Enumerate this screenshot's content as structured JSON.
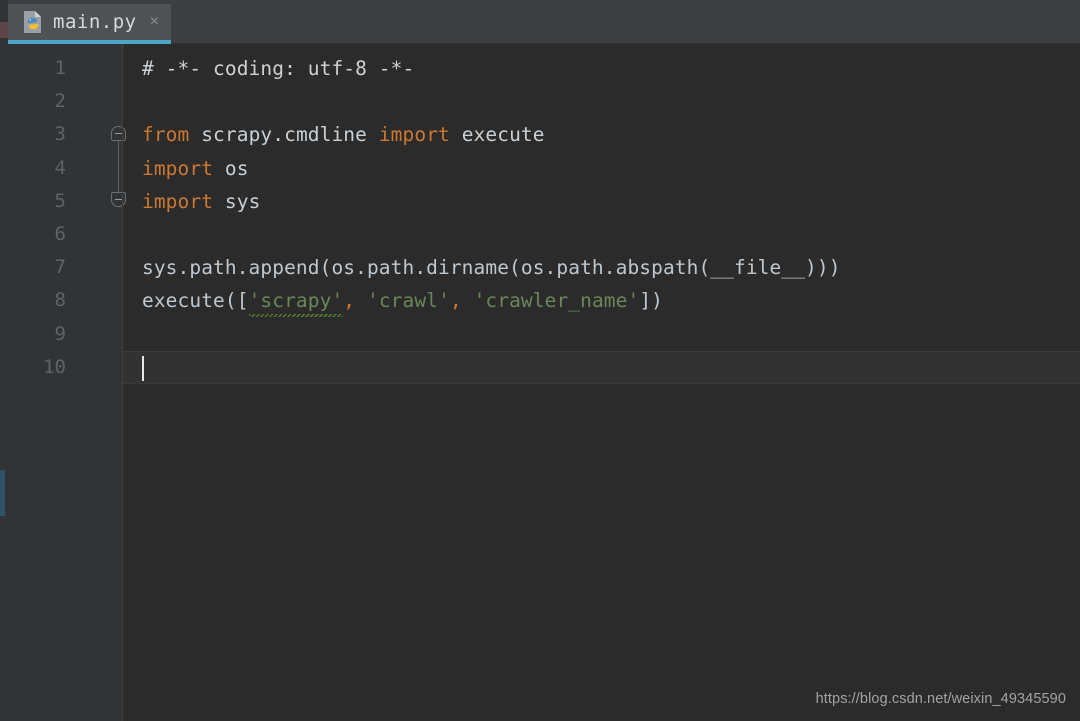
{
  "window": {
    "theme_editor_bg": "#2b2b2b",
    "theme_gutter_bg": "#313335",
    "theme_tabbar_bg": "#3c3f41",
    "accent_color": "#4ba6c9",
    "keyword_color": "#cc7832",
    "string_color": "#6a8759",
    "text_color": "#a9b7c6"
  },
  "tab": {
    "label": "main.py",
    "close_label": "×",
    "icon": "python-file-icon"
  },
  "gutter": {
    "line_numbers": [
      "1",
      "2",
      "3",
      "4",
      "5",
      "6",
      "7",
      "8",
      "9",
      "10"
    ],
    "fold_markers": [
      {
        "line": 3,
        "type": "fold-region-start"
      },
      {
        "line": 5,
        "type": "fold-region-end"
      }
    ]
  },
  "editor": {
    "current_line": 10,
    "caret_line": 10,
    "caret_column": 1,
    "lines": [
      {
        "number": "1",
        "tokens": [
          {
            "text": "# -*- coding: utf-8 -*-",
            "type": "comment"
          }
        ]
      },
      {
        "number": "2",
        "tokens": []
      },
      {
        "number": "3",
        "tokens": [
          {
            "text": "from",
            "type": "keyword"
          },
          {
            "text": " ",
            "type": "plain"
          },
          {
            "text": "scrapy.cmdline",
            "type": "identifier"
          },
          {
            "text": " ",
            "type": "plain"
          },
          {
            "text": "import",
            "type": "keyword"
          },
          {
            "text": " ",
            "type": "plain"
          },
          {
            "text": "execute",
            "type": "identifier"
          }
        ]
      },
      {
        "number": "4",
        "tokens": [
          {
            "text": "import",
            "type": "keyword"
          },
          {
            "text": " ",
            "type": "plain"
          },
          {
            "text": "os",
            "type": "identifier"
          }
        ]
      },
      {
        "number": "5",
        "tokens": [
          {
            "text": "import",
            "type": "keyword"
          },
          {
            "text": " ",
            "type": "plain"
          },
          {
            "text": "sys",
            "type": "identifier"
          }
        ]
      },
      {
        "number": "6",
        "tokens": []
      },
      {
        "number": "7",
        "tokens": [
          {
            "text": "sys.path.append(os.path.dirname(os.path.abspath(__file__)))",
            "type": "plain"
          }
        ]
      },
      {
        "number": "8",
        "tokens": [
          {
            "text": "execute([",
            "type": "plain"
          },
          {
            "text": "'scrapy'",
            "type": "string-misspelled"
          },
          {
            "text": ",",
            "type": "punct"
          },
          {
            "text": " ",
            "type": "plain"
          },
          {
            "text": "'crawl'",
            "type": "string"
          },
          {
            "text": ",",
            "type": "punct"
          },
          {
            "text": " ",
            "type": "plain"
          },
          {
            "text": "'crawler_name'",
            "type": "string"
          },
          {
            "text": "])",
            "type": "plain"
          }
        ]
      },
      {
        "number": "9",
        "tokens": []
      },
      {
        "number": "10",
        "tokens": []
      }
    ]
  },
  "watermark": {
    "text": "https://blog.csdn.net/weixin_49345590"
  }
}
